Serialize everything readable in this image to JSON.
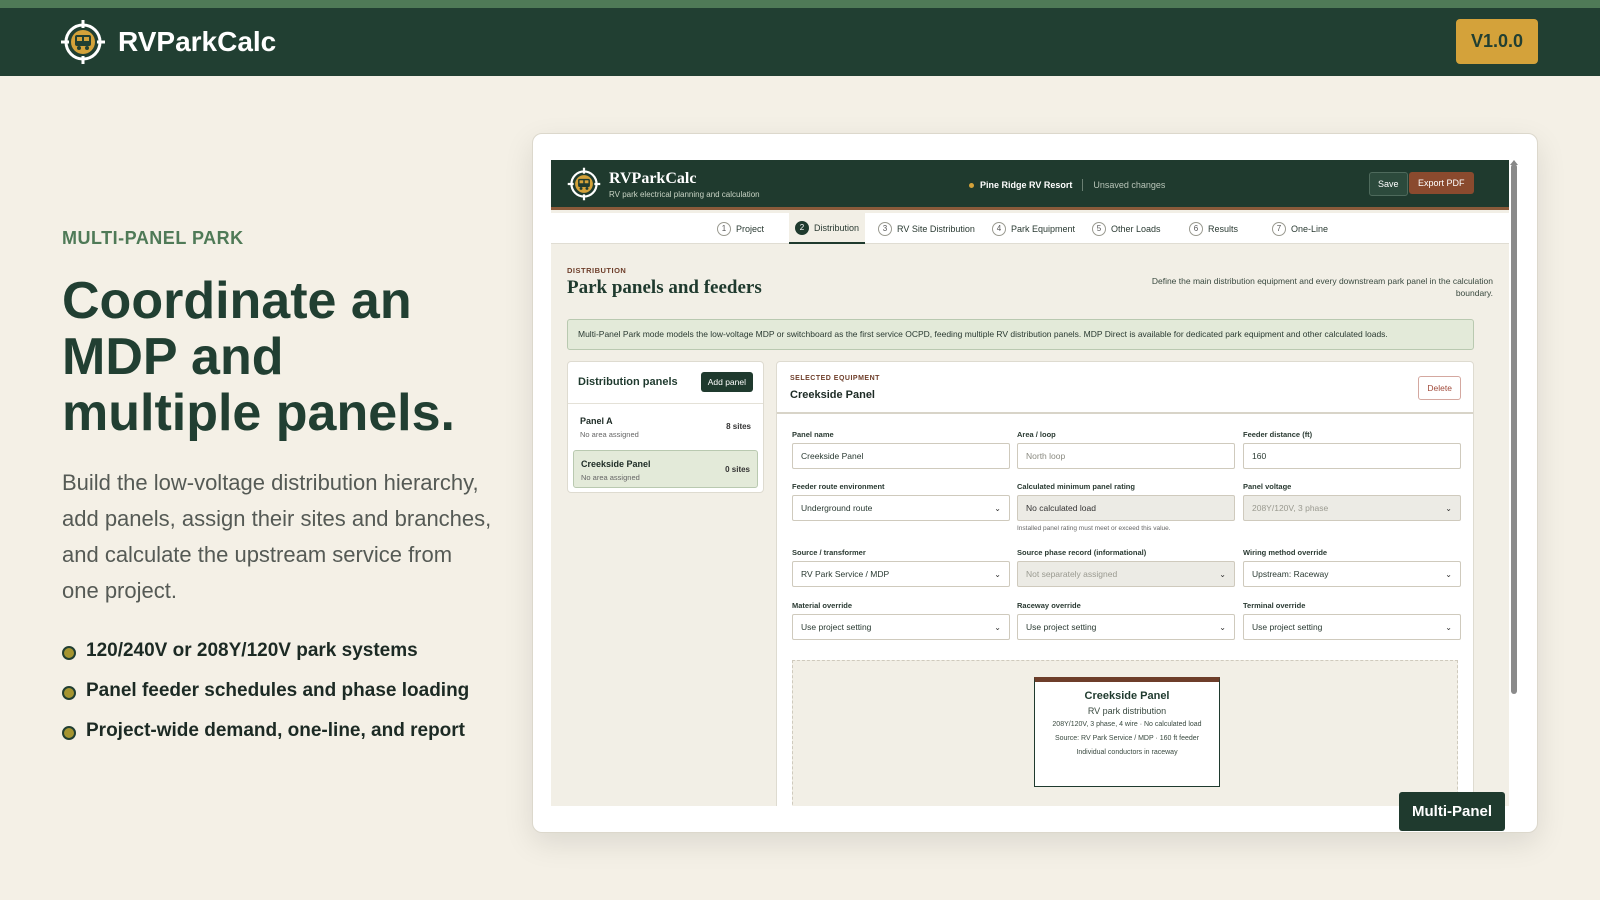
{
  "header": {
    "brand": "RVParkCalc",
    "version": "V1.0.0"
  },
  "hero": {
    "eyebrow": "MULTI-PANEL PARK",
    "headline": "Coordinate an MDP and multiple panels.",
    "subtitle": "Build the low-voltage distribution hierarchy, add panels, assign their sites and branches, and calculate the upstream service from one project.",
    "bullets": [
      "120/240V or 208Y/120V park systems",
      "Panel feeder schedules and phase loading",
      "Project-wide demand, one-line, and report"
    ]
  },
  "app": {
    "title": "RVParkCalc",
    "tagline": "RV park electrical planning and calculation",
    "project_name": "Pine Ridge RV Resort",
    "status": "Unsaved changes",
    "save_label": "Save",
    "export_label": "Export PDF",
    "tabs": [
      {
        "num": "1",
        "label": "Project"
      },
      {
        "num": "2",
        "label": "Distribution"
      },
      {
        "num": "3",
        "label": "RV Site Distribution"
      },
      {
        "num": "4",
        "label": "Park Equipment"
      },
      {
        "num": "5",
        "label": "Other Loads"
      },
      {
        "num": "6",
        "label": "Results"
      },
      {
        "num": "7",
        "label": "One-Line"
      }
    ],
    "active_tab": "Distribution",
    "section_eyebrow": "DISTRIBUTION",
    "section_title": "Park panels and feeders",
    "section_desc": "Define the main distribution equipment and every downstream park panel in the calculation boundary.",
    "info_note": "Multi-Panel Park mode models the low-voltage MDP or switchboard as the first service OCPD, feeding multiple RV distribution panels. MDP Direct is available for dedicated park equipment and other calculated loads.",
    "panels": {
      "title": "Distribution panels",
      "add_label": "Add panel",
      "items": [
        {
          "name": "Panel A",
          "area": "No area assigned",
          "sites": "8 sites"
        },
        {
          "name": "Creekside Panel",
          "area": "No area assigned",
          "sites": "0 sites"
        }
      ]
    },
    "detail": {
      "eyebrow": "SELECTED EQUIPMENT",
      "title": "Creekside Panel",
      "delete_label": "Delete",
      "fields": {
        "panel_name": {
          "label": "Panel name",
          "value": "Creekside Panel"
        },
        "area": {
          "label": "Area / loop",
          "placeholder": "North loop"
        },
        "feeder_distance": {
          "label": "Feeder distance (ft)",
          "value": "160"
        },
        "route_env": {
          "label": "Feeder route environment",
          "value": "Underground route"
        },
        "min_rating": {
          "label": "Calculated minimum panel rating",
          "value": "No calculated load",
          "hint": "Installed panel rating must meet or exceed this value."
        },
        "panel_voltage": {
          "label": "Panel voltage",
          "value": "208Y/120V, 3 phase"
        },
        "source": {
          "label": "Source / transformer",
          "value": "RV Park Service / MDP"
        },
        "phase_record": {
          "label": "Source phase record (informational)",
          "value": "Not separately assigned"
        },
        "wiring_override": {
          "label": "Wiring method override",
          "value": "Upstream: Raceway"
        },
        "material_override": {
          "label": "Material override",
          "value": "Use project setting"
        },
        "raceway_override": {
          "label": "Raceway override",
          "value": "Use project setting"
        },
        "terminal_override": {
          "label": "Terminal override",
          "value": "Use project setting"
        }
      },
      "diagram": {
        "title": "Creekside Panel",
        "subtitle": "RV park distribution",
        "line1": "208Y/120V, 3 phase, 4 wire · No calculated load",
        "line2": "Source: RV Park Service / MDP · 160 ft feeder",
        "line3": "Individual conductors in raceway"
      }
    }
  },
  "badge": "Multi-Panel"
}
